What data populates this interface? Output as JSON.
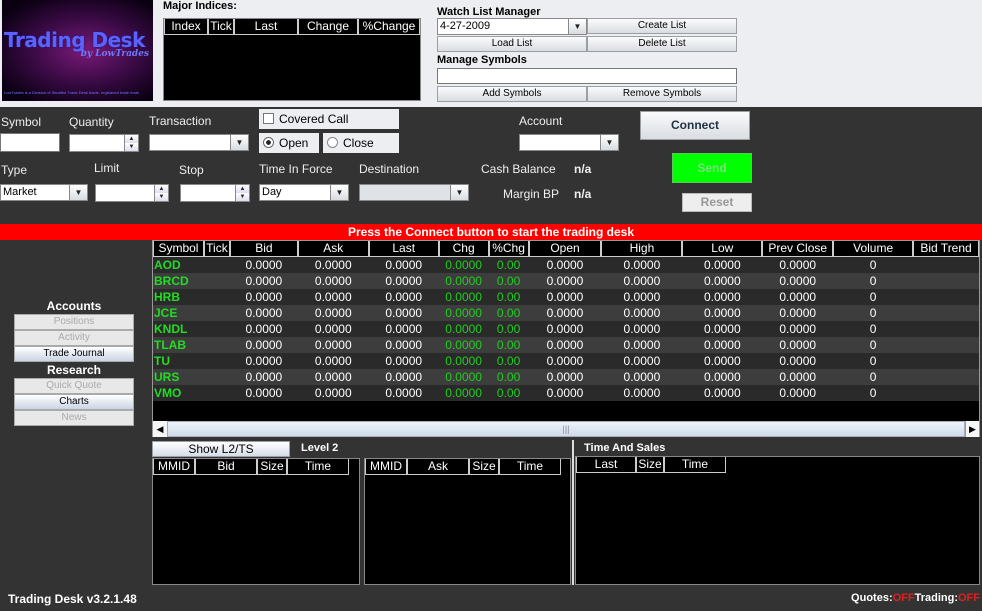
{
  "logo": {
    "title": "Trading Desk",
    "subtitle": "by LowTrades",
    "fine_print": "LowTrades is a Division of Stealthe Trade Desk Aside, registered trade mark"
  },
  "indices": {
    "label": "Major Indices:",
    "columns": [
      "Index",
      "Tick",
      "Last",
      "Change",
      "%Change"
    ]
  },
  "watchlist": {
    "label": "Watch List Manager",
    "selected": "4-27-2009",
    "create": "Create List",
    "load": "Load List",
    "delete": "Delete List",
    "manage_label": "Manage Symbols",
    "symbols_value": "",
    "add": "Add Symbols",
    "remove": "Remove Symbols"
  },
  "order": {
    "symbol_label": "Symbol",
    "quantity_label": "Quantity",
    "transaction_label": "Transaction",
    "covered_call": "Covered Call",
    "covered_call_checked": false,
    "open": "Open",
    "close": "Close",
    "open_selected": true,
    "account_label": "Account",
    "connect": "Connect",
    "type_label": "Type",
    "type_value": "Market",
    "limit_label": "Limit",
    "stop_label": "Stop",
    "tif_label": "Time In Force",
    "tif_value": "Day",
    "destination_label": "Destination",
    "cash_label": "Cash Balance",
    "cash_value": "n/a",
    "margin_label": "Margin BP",
    "margin_value": "n/a",
    "send": "Send",
    "reset": "Reset"
  },
  "banner": "Press the Connect button to start the trading desk",
  "sidebar": {
    "accounts": "Accounts",
    "account_items": [
      {
        "label": "Positions",
        "enabled": false
      },
      {
        "label": "Activity",
        "enabled": false
      },
      {
        "label": "Trade Journal",
        "enabled": true
      }
    ],
    "research": "Research",
    "research_items": [
      {
        "label": "Quick Quote",
        "enabled": false
      },
      {
        "label": "Charts",
        "enabled": true
      },
      {
        "label": "News",
        "enabled": false
      }
    ]
  },
  "grid": {
    "columns": [
      "Symbol",
      "Tick",
      "Bid",
      "Ask",
      "Last",
      "Chg",
      "%Chg",
      "Open",
      "High",
      "Low",
      "Prev Close",
      "Volume",
      "Bid Trend"
    ],
    "rows": [
      [
        "AOD",
        "",
        "0.0000",
        "0.0000",
        "0.0000",
        "0.0000",
        "0.00",
        "0.0000",
        "0.0000",
        "0.0000",
        "0.0000",
        "0",
        ""
      ],
      [
        "BRCD",
        "",
        "0.0000",
        "0.0000",
        "0.0000",
        "0.0000",
        "0.00",
        "0.0000",
        "0.0000",
        "0.0000",
        "0.0000",
        "0",
        ""
      ],
      [
        "HRB",
        "",
        "0.0000",
        "0.0000",
        "0.0000",
        "0.0000",
        "0.00",
        "0.0000",
        "0.0000",
        "0.0000",
        "0.0000",
        "0",
        ""
      ],
      [
        "JCE",
        "",
        "0.0000",
        "0.0000",
        "0.0000",
        "0.0000",
        "0.00",
        "0.0000",
        "0.0000",
        "0.0000",
        "0.0000",
        "0",
        ""
      ],
      [
        "KNDL",
        "",
        "0.0000",
        "0.0000",
        "0.0000",
        "0.0000",
        "0.00",
        "0.0000",
        "0.0000",
        "0.0000",
        "0.0000",
        "0",
        ""
      ],
      [
        "TLAB",
        "",
        "0.0000",
        "0.0000",
        "0.0000",
        "0.0000",
        "0.00",
        "0.0000",
        "0.0000",
        "0.0000",
        "0.0000",
        "0",
        ""
      ],
      [
        "TU",
        "",
        "0.0000",
        "0.0000",
        "0.0000",
        "0.0000",
        "0.00",
        "0.0000",
        "0.0000",
        "0.0000",
        "0.0000",
        "0",
        ""
      ],
      [
        "URS",
        "",
        "0.0000",
        "0.0000",
        "0.0000",
        "0.0000",
        "0.00",
        "0.0000",
        "0.0000",
        "0.0000",
        "0.0000",
        "0",
        ""
      ],
      [
        "VMO",
        "",
        "0.0000",
        "0.0000",
        "0.0000",
        "0.0000",
        "0.00",
        "0.0000",
        "0.0000",
        "0.0000",
        "0.0000",
        "0",
        ""
      ]
    ]
  },
  "level2": {
    "show_button": "Show L2/TS",
    "label": "Level 2",
    "bid_columns": [
      "MMID",
      "Bid",
      "Size",
      "Time"
    ],
    "ask_columns": [
      "MMID",
      "Ask",
      "Size",
      "Time"
    ]
  },
  "tas": {
    "label": "Time And Sales",
    "columns": [
      "Last",
      "Size",
      "Time"
    ]
  },
  "status": {
    "version": "Trading Desk v3.2.1.48",
    "quotes_label": "Quotes:",
    "quotes_value": "OFF",
    "trading_label": "Trading:",
    "trading_value": "OFF"
  },
  "colors": {
    "banner": "#ff0000",
    "send": "#00ff00",
    "positive": "#22cc22",
    "off": "#e02020"
  }
}
